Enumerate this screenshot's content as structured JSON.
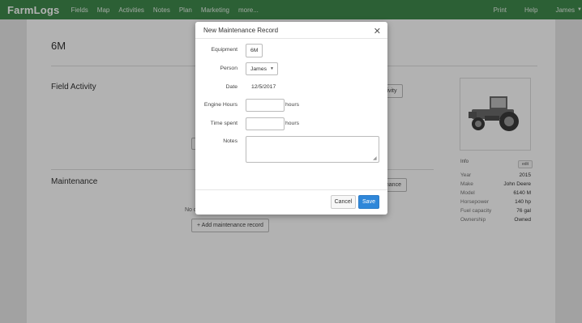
{
  "nav": {
    "logo": "FarmLogs",
    "items": [
      "Fields",
      "Map",
      "Activities",
      "Notes",
      "Plan",
      "Marketing",
      "more..."
    ],
    "print": "Print",
    "help": "Help",
    "user": "James"
  },
  "page": {
    "title": "6M",
    "field_activity": {
      "heading": "Field Activity",
      "add_button_partial": "ctivity"
    },
    "maintenance": {
      "heading": "Maintenance",
      "add_button_partial": "enance",
      "empty_partial": "No c",
      "add_record_button": "+ Add maintenance record"
    },
    "info": {
      "label": "Info",
      "edit": "edit",
      "specs": [
        {
          "key": "Year",
          "value": "2015"
        },
        {
          "key": "Make",
          "value": "John Deere"
        },
        {
          "key": "Model",
          "value": "6140 M"
        },
        {
          "key": "Horsepower",
          "value": "140 hp"
        },
        {
          "key": "Fuel capacity",
          "value": "76 gal"
        },
        {
          "key": "Ownership",
          "value": "Owned"
        }
      ]
    }
  },
  "modal": {
    "title": "New Maintenance Record",
    "fields": {
      "equipment_label": "Equipment",
      "equipment_value": "6M",
      "person_label": "Person",
      "person_value": "James",
      "date_label": "Date",
      "date_value": "12/5/2017",
      "engine_hours_label": "Engine Hours",
      "engine_hours_value": "",
      "engine_hours_unit": "hours",
      "time_spent_label": "Time spent",
      "time_spent_value": "",
      "time_spent_unit": "hours",
      "notes_label": "Notes",
      "notes_value": ""
    },
    "cancel": "Cancel",
    "save": "Save"
  },
  "colors": {
    "nav_green": "#3f8a4c",
    "primary_blue": "#2f87d9"
  }
}
